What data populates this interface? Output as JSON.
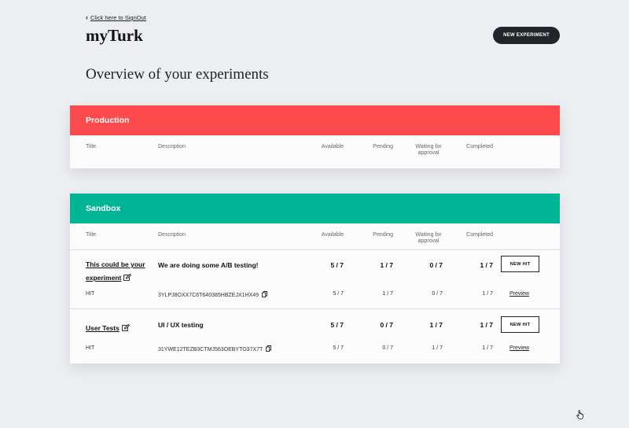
{
  "header": {
    "signout_label": "Click here to SignOut",
    "brand": "myTurk",
    "new_experiment_label": "NEW EXPERIMENT",
    "page_title": "Overview of your experiments"
  },
  "columns": {
    "title": "Title",
    "description": "Description",
    "available": "Available",
    "pending": "Pending",
    "waiting_line1": "Waiting for",
    "waiting_line2": "approval",
    "completed": "Completed"
  },
  "production": {
    "heading": "Production",
    "header_color": "#fd4a4c"
  },
  "sandbox": {
    "heading": "Sandbox",
    "header_color": "#00b496",
    "experiments": [
      {
        "title_line1": "This could be your",
        "title_line2": "experiment",
        "description": "We are doing some A/B testing!",
        "available": "5 / 7",
        "pending": "1 / 7",
        "waiting": "0 / 7",
        "completed": "1 / 7",
        "new_hit_label": "NEW HIT",
        "hit": {
          "label": "HIT",
          "id": "3YLPJ8OXX7C6T640385HBZEJX1HX49",
          "available": "5 / 7",
          "pending": "1 / 7",
          "waiting": "0 / 7",
          "completed": "1 / 7",
          "preview_label": "Preview"
        }
      },
      {
        "title_line1": "User Tests",
        "description": "UI / UX testing",
        "available": "5 / 7",
        "pending": "0 / 7",
        "waiting": "1 / 7",
        "completed": "1 / 7",
        "new_hit_label": "NEW HIT",
        "hit": {
          "label": "HIT",
          "id": "31YWE12TEZB3CTMJ563OEBYTO37X7T",
          "available": "5 / 7",
          "pending": "0 / 7",
          "waiting": "1 / 7",
          "completed": "1 / 7",
          "preview_label": "Preview"
        }
      }
    ]
  }
}
